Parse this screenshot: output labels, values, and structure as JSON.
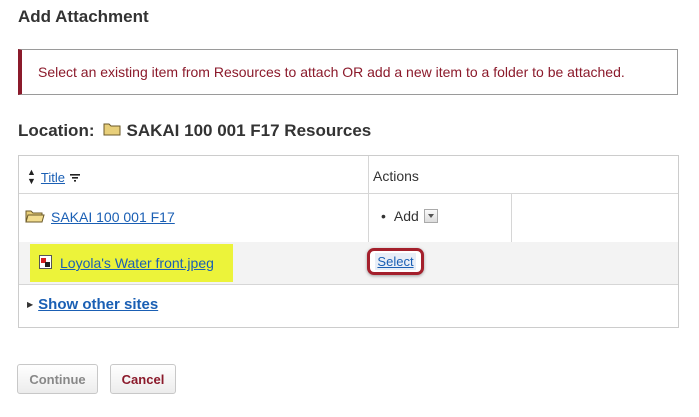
{
  "page": {
    "title": "Add Attachment"
  },
  "alert": {
    "text": "Select an existing item from Resources to attach OR add a new item to a folder to be attached."
  },
  "location": {
    "label": "Location:",
    "name": "SAKAI 100 001 F17 Resources"
  },
  "table": {
    "header": {
      "title": "Title",
      "actions": "Actions"
    },
    "folder_row": {
      "name": "SAKAI 100 001 F17",
      "action_label": "Add"
    },
    "file_row": {
      "name": "Loyola's Water front.jpeg",
      "action_label": "Select"
    },
    "other_sites_label": "Show other sites"
  },
  "buttons": {
    "continue": "Continue",
    "cancel": "Cancel"
  },
  "colors": {
    "accent": "#8b1a2b",
    "link": "#1a5fb4",
    "highlight": "#ecf33a"
  }
}
